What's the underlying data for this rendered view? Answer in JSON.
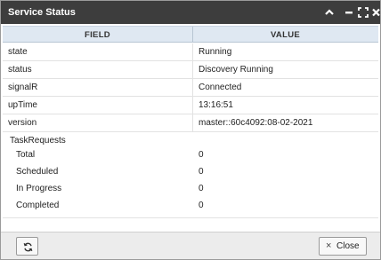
{
  "window": {
    "title": "Service Status"
  },
  "table": {
    "headers": {
      "field": "FIELD",
      "value": "VALUE"
    },
    "rows": [
      {
        "field": "state",
        "value": "Running"
      },
      {
        "field": "status",
        "value": "Discovery Running"
      },
      {
        "field": "signalR",
        "value": "Connected"
      },
      {
        "field": "upTime",
        "value": "13:16:51"
      },
      {
        "field": "version",
        "value": "master::60c4092:08-02-2021"
      }
    ]
  },
  "task_requests": {
    "title": "TaskRequests",
    "items": [
      {
        "label": "Total",
        "value": "0"
      },
      {
        "label": "Scheduled",
        "value": "0"
      },
      {
        "label": "In Progress",
        "value": "0"
      },
      {
        "label": "Completed",
        "value": "0"
      }
    ]
  },
  "footer": {
    "close_label": "Close",
    "refresh_icon": "refresh-icon",
    "close_icon": "close-x-icon"
  },
  "colors": {
    "titlebar": "#3d3d3d",
    "header_bg": "#dfe8f2",
    "footer_bg": "#ececec"
  }
}
